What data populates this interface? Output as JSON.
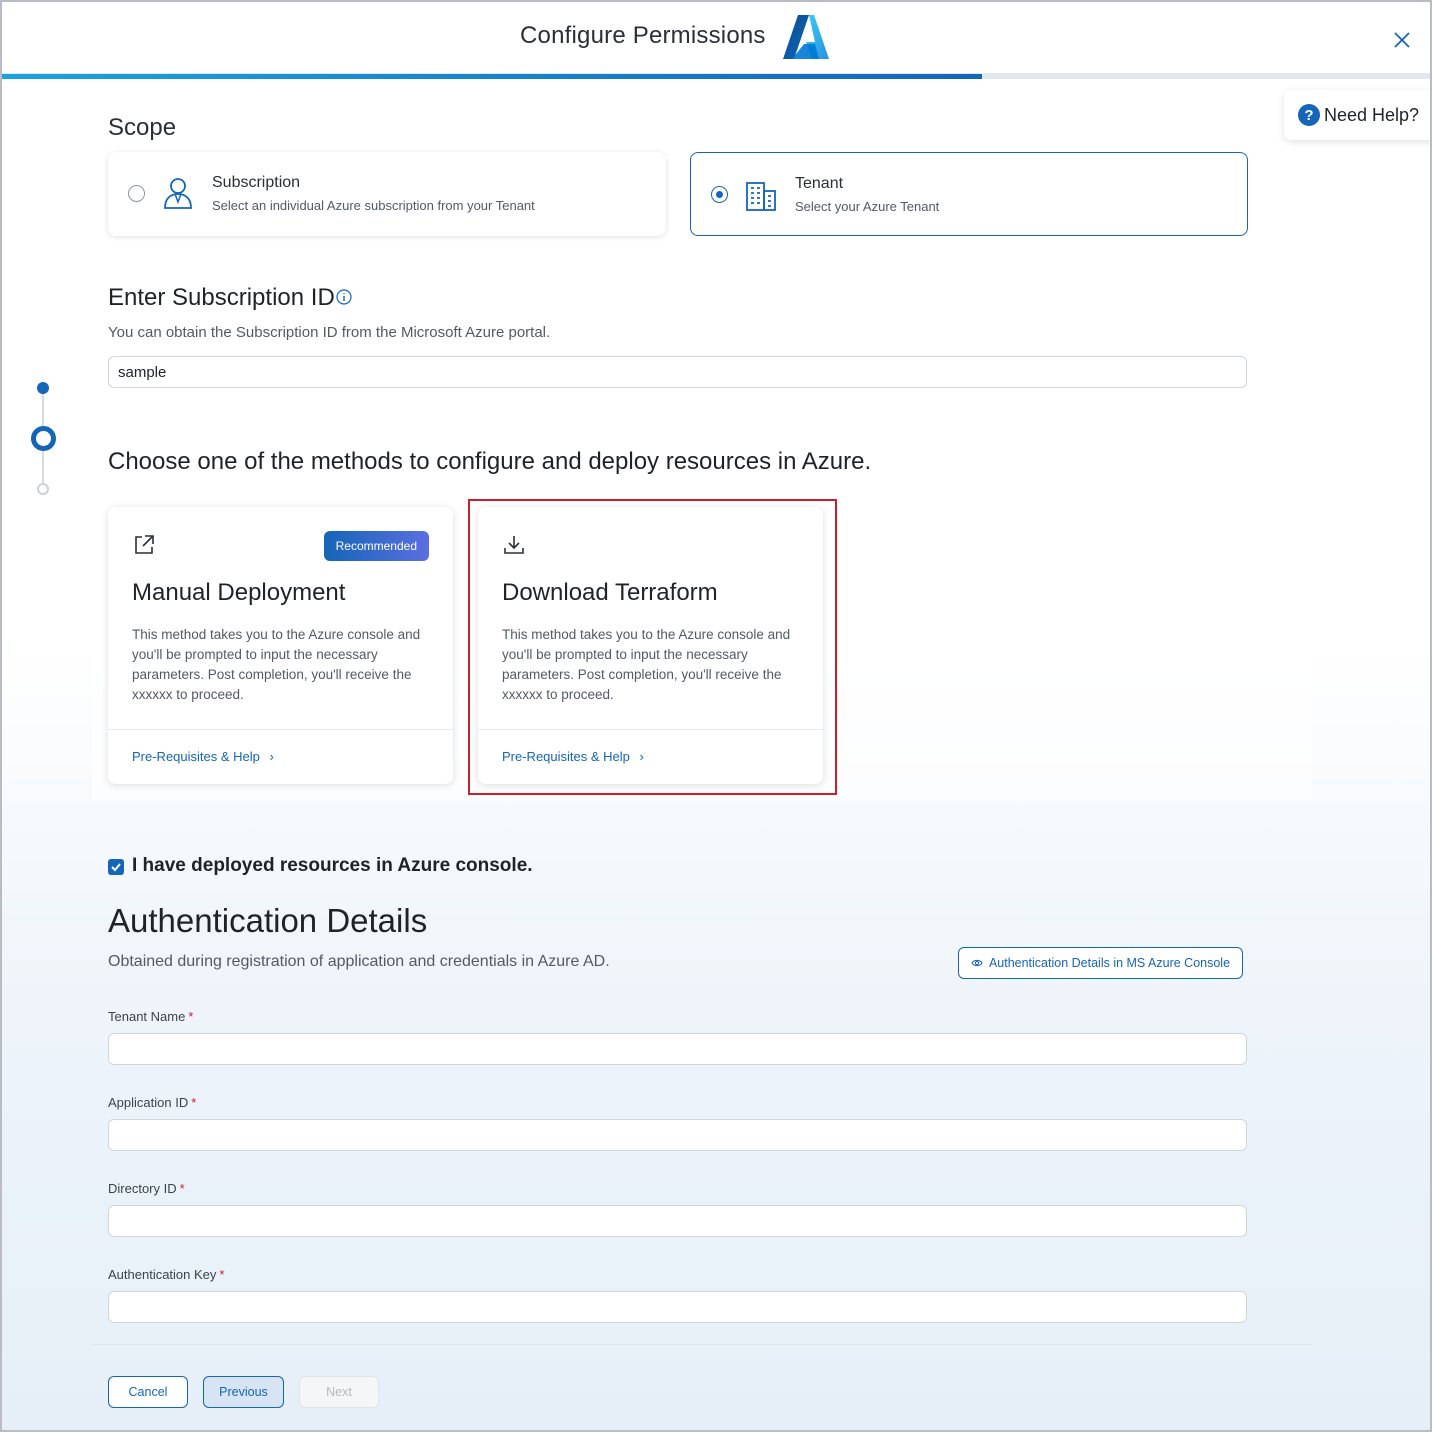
{
  "header": {
    "title": "Configure Permissions",
    "close_label": "Close",
    "progress_fraction": 0.686
  },
  "help": {
    "label": "Need Help?"
  },
  "stepper": {
    "steps": 3,
    "current_step": 2
  },
  "scope": {
    "label": "Scope",
    "options": [
      {
        "title": "Subscription",
        "description": "Select an individual Azure subscription from your Tenant",
        "selected": false,
        "icon": "user-icon"
      },
      {
        "title": "Tenant",
        "description": "Select your Azure Tenant",
        "selected": true,
        "icon": "building-icon"
      }
    ]
  },
  "subscription": {
    "title": "Enter Subscription ID",
    "description": "You can obtain the Subscription ID from the Microsoft Azure portal.",
    "value": "sample"
  },
  "methods": {
    "title": "Choose one of the methods to configure and deploy resources in Azure.",
    "cards": [
      {
        "title": "Manual Deployment",
        "badge": "Recommended",
        "icon": "external-link-icon",
        "description": "This method takes you to the Azure console and you'll be prompted to input the necessary parameters. Post completion, you'll receive the xxxxxx to proceed.",
        "link": "Pre-Requisites & Help"
      },
      {
        "title": "Download Terraform",
        "icon": "download-icon",
        "description": "This method takes you to the Azure console and you'll be prompted to input the necessary parameters. Post completion, you'll receive the xxxxxx to proceed.",
        "link": "Pre-Requisites & Help"
      }
    ]
  },
  "deployed_check": {
    "label": "I have deployed resources in Azure console.",
    "checked": true
  },
  "auth": {
    "title": "Authentication Details",
    "description": "Obtained during registration of application and credentials in Azure AD.",
    "console_button": "Authentication Details in MS Azure Console",
    "fields": [
      {
        "label": "Tenant Name",
        "required_mark": "*",
        "value": ""
      },
      {
        "label": "Application ID",
        "required_mark": "*",
        "value": ""
      },
      {
        "label": "Directory ID",
        "required_mark": "*",
        "value": ""
      },
      {
        "label": "Authentication Key",
        "required_mark": "*",
        "value": ""
      }
    ]
  },
  "footer": {
    "cancel": "Cancel",
    "previous": "Previous",
    "next": "Next"
  },
  "colors": {
    "accent": "#1565b8",
    "highlight": "#cc1f2a",
    "required": "#cc1f2a"
  }
}
